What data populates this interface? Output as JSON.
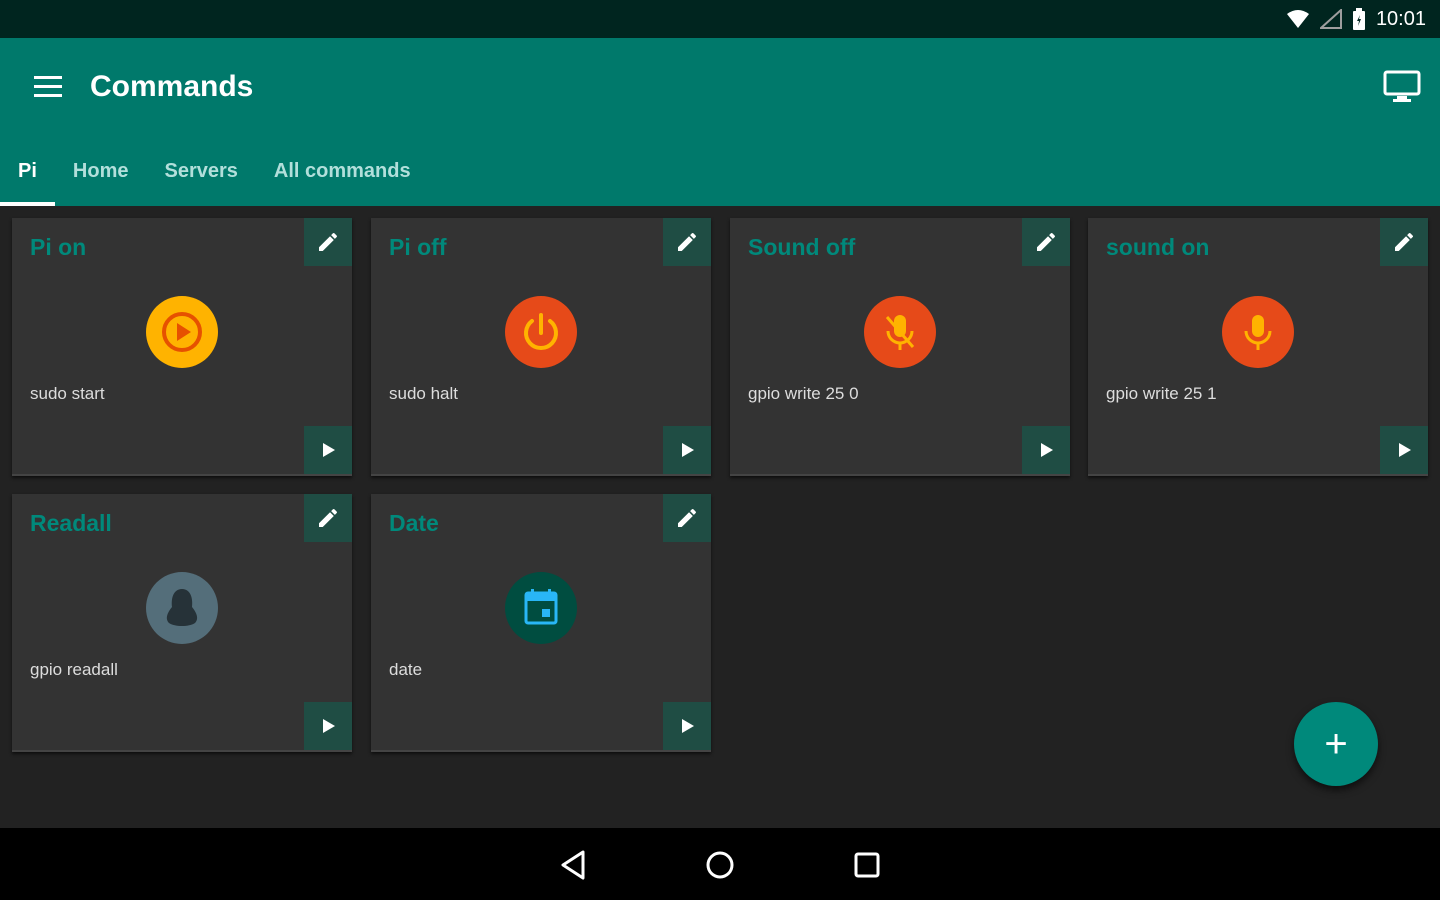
{
  "status_bar": {
    "time": "10:01",
    "icons": [
      "wifi-icon",
      "cell-signal-icon",
      "battery-icon"
    ]
  },
  "app_bar": {
    "title": "Commands",
    "menu_icon": "hamburger-menu-icon",
    "action_icon": "monitor-icon"
  },
  "tabs": [
    {
      "label": "Pi",
      "active": true
    },
    {
      "label": "Home",
      "active": false
    },
    {
      "label": "Servers",
      "active": false
    },
    {
      "label": "All commands",
      "active": false
    }
  ],
  "cards": [
    {
      "title": "Pi on",
      "command": "sudo start",
      "icon": "play-circle-icon",
      "icon_color": "#ffb300"
    },
    {
      "title": "Pi off",
      "command": "sudo halt",
      "icon": "power-icon",
      "icon_color": "#e64a19"
    },
    {
      "title": "Sound off",
      "command": "gpio write 25 0",
      "icon": "mic-off-icon",
      "icon_color": "#e64a19"
    },
    {
      "title": "sound on",
      "command": "gpio write 25 1",
      "icon": "mic-icon",
      "icon_color": "#e64a19"
    },
    {
      "title": "Readall",
      "command": "gpio readall",
      "icon": "linux-tux-icon",
      "icon_color": "#546e7a"
    },
    {
      "title": "Date",
      "command": "date",
      "icon": "calendar-icon",
      "icon_color": "#004d40"
    }
  ],
  "fab": {
    "label": "+",
    "icon": "add-icon"
  },
  "nav_bar": {
    "icons": [
      "back-icon",
      "home-icon",
      "recents-icon"
    ]
  },
  "colors": {
    "primary": "#00796b",
    "primary_dark": "#00251f",
    "accent": "#00897b",
    "card_bg": "#333333",
    "page_bg": "#222222"
  }
}
